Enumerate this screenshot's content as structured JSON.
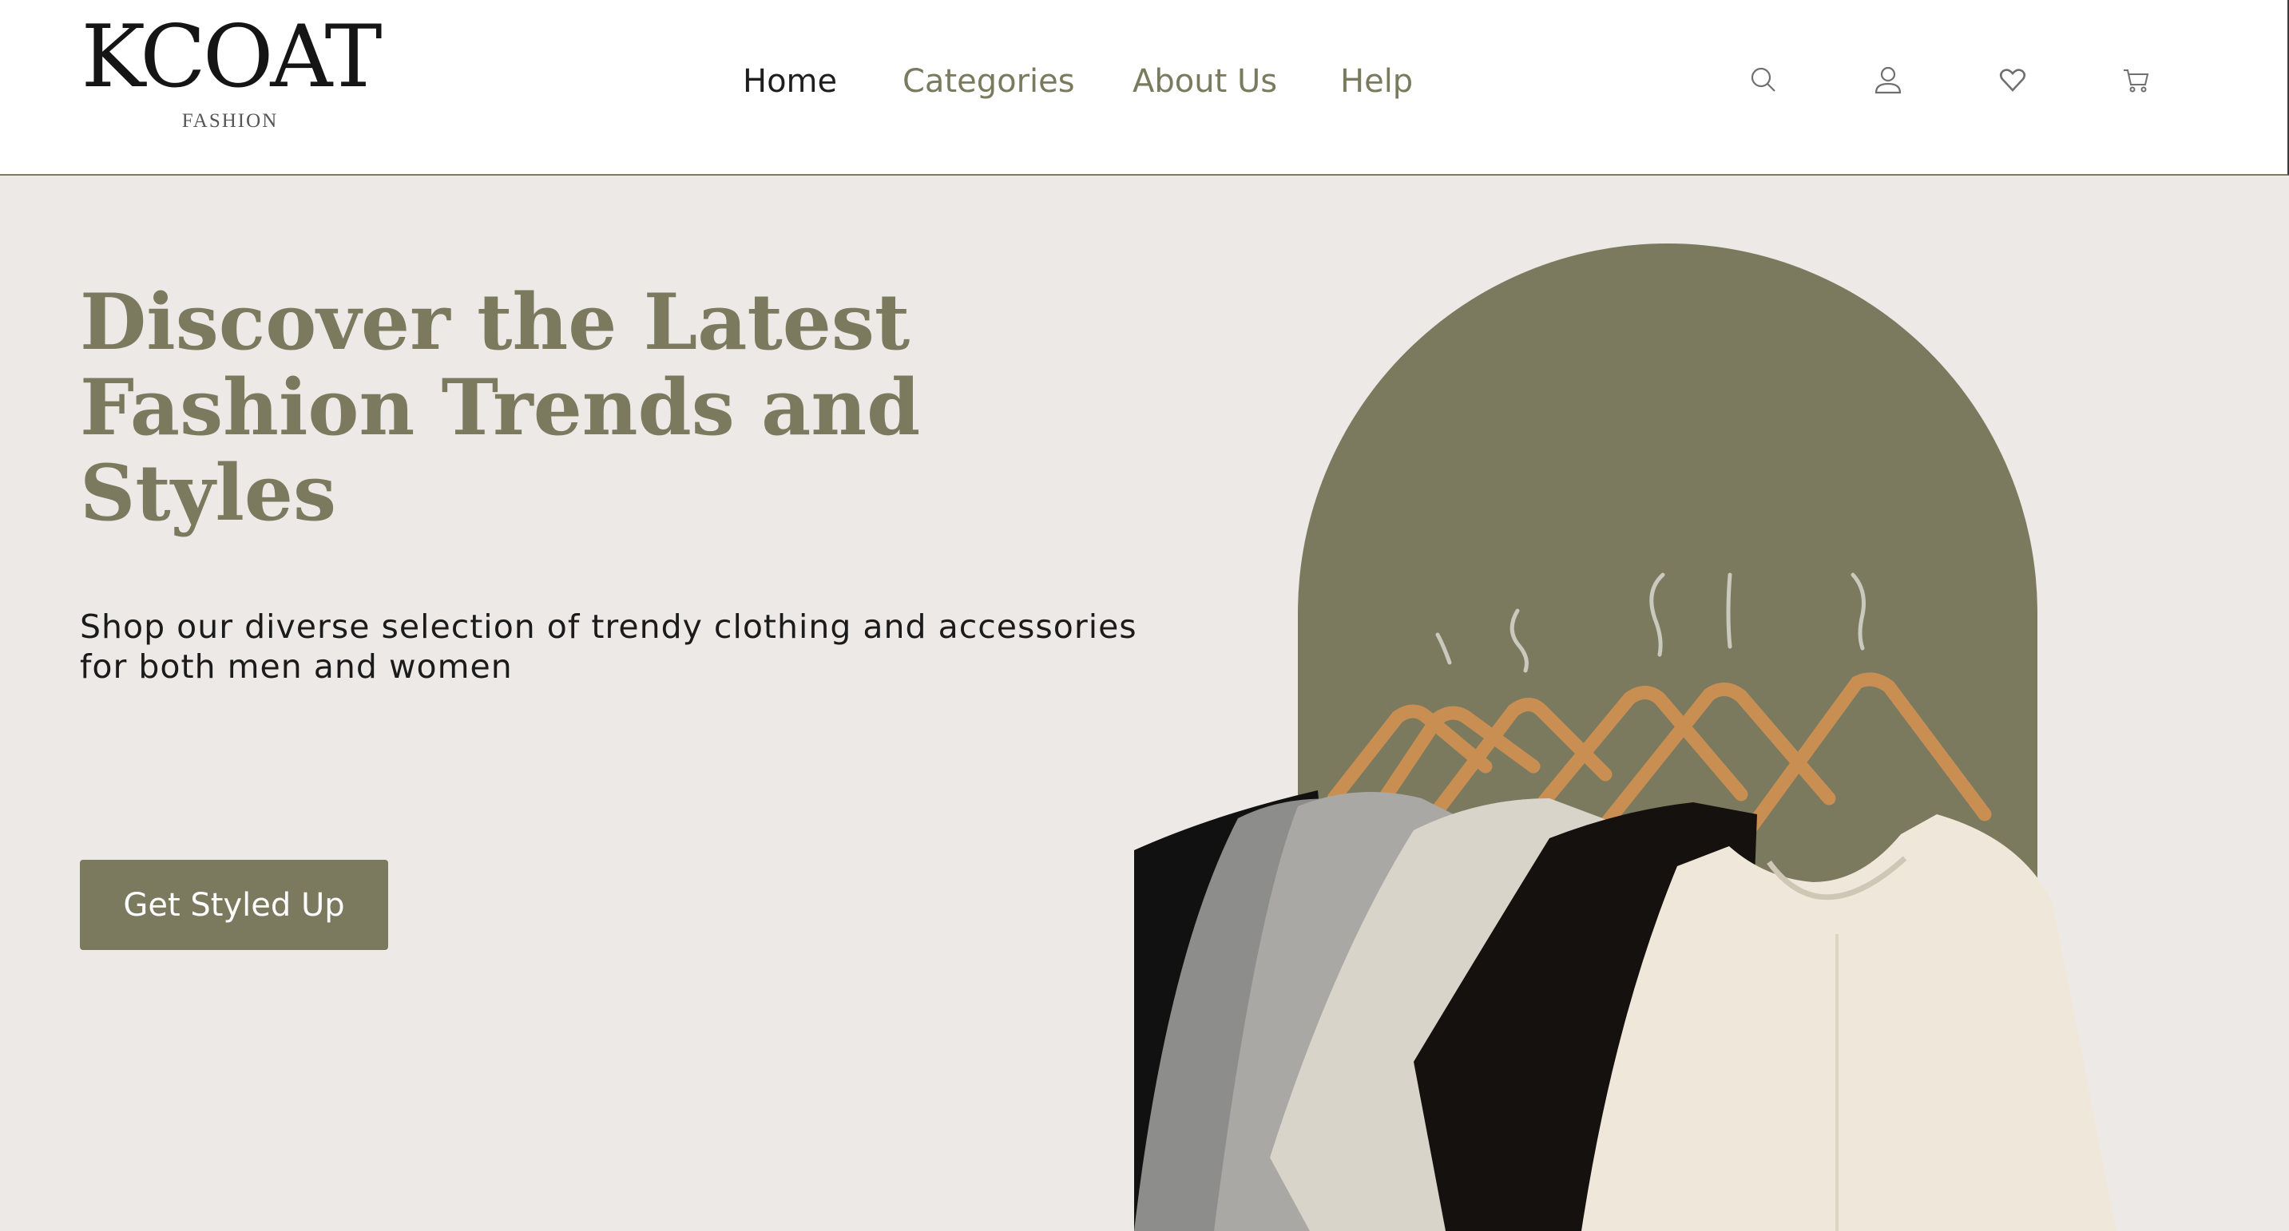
{
  "brand": {
    "name": "KCOAT",
    "tagline": "FASHION"
  },
  "nav": {
    "items": [
      {
        "label": "Home",
        "active": true
      },
      {
        "label": "Categories",
        "active": false
      },
      {
        "label": "About Us",
        "active": false
      },
      {
        "label": "Help",
        "active": false
      }
    ]
  },
  "header_icons": [
    "search-icon",
    "user-icon",
    "heart-icon",
    "cart-icon"
  ],
  "hero": {
    "headline_lines": [
      "Discover the Latest",
      "Fashion Trends and",
      "Styles"
    ],
    "subtext_lines": [
      "Shop our diverse selection of trendy clothing and accessories",
      "for both men and women"
    ],
    "cta_label": "Get Styled Up"
  },
  "colors": {
    "accent": "#7b7a5f",
    "hero_background": "#ede9e6",
    "text_dark": "#1b1b1b",
    "nav_active": "#1e1e1e"
  }
}
